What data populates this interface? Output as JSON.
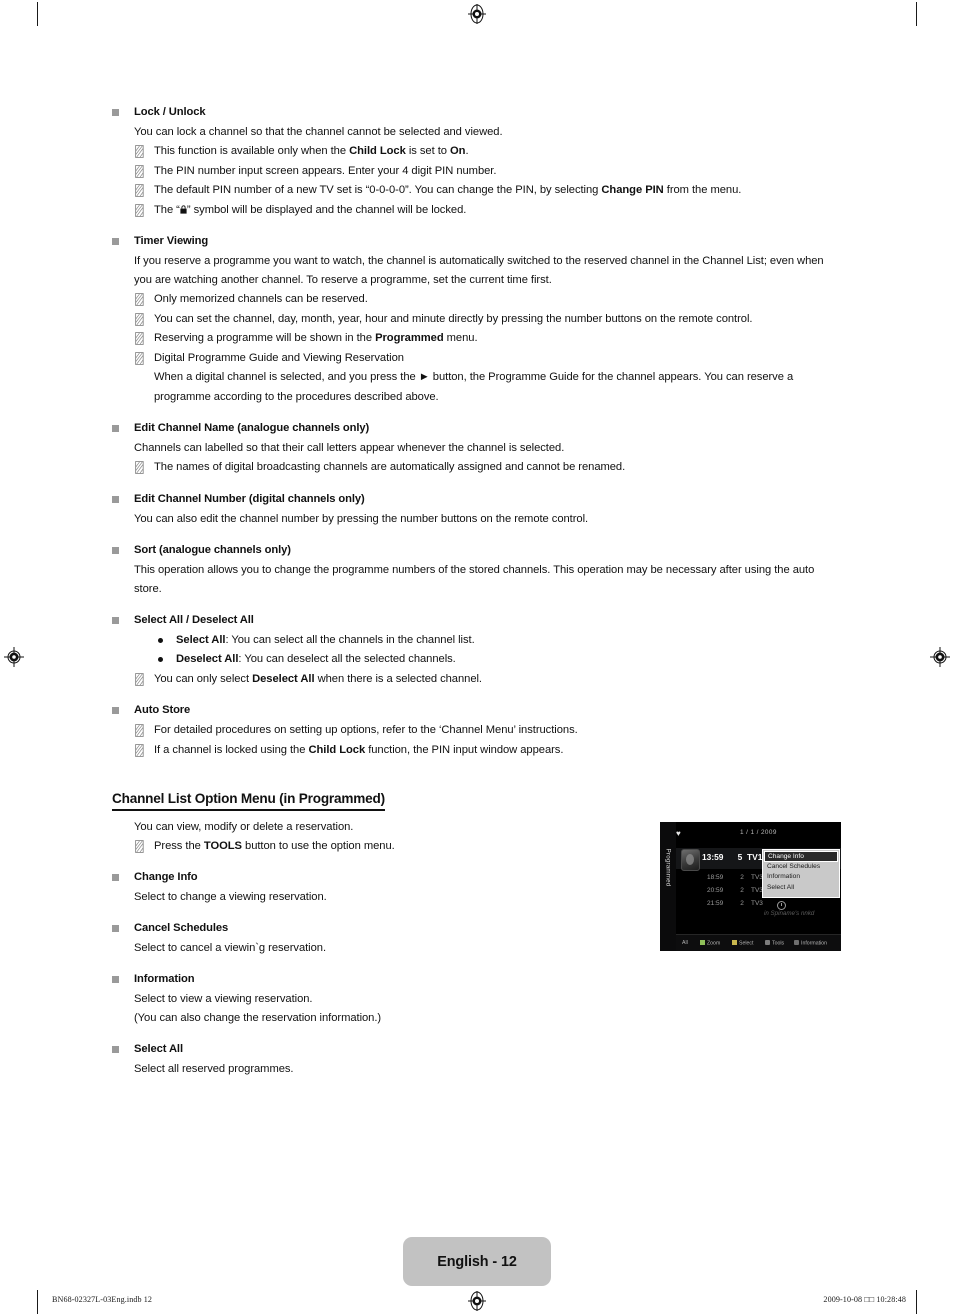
{
  "page": {
    "footer_tab_label": "English - 12",
    "colophon_left": "BN68-02327L-03Eng.indb   12",
    "colophon_right": "2009-10-08   □□ 10:28:48"
  },
  "sections": [
    {
      "heading": "Lock / Unlock",
      "body": "You can lock a channel so that the channel cannot be selected and viewed.",
      "notes": [
        "This function is available only when the Child Lock is set to On.",
        "The PIN number input screen appears. Enter your 4 digit PIN number.",
        "The default PIN number of a new TV set is “0-0-0-0”. You can change the PIN, by selecting Change PIN from the menu.",
        "The “🔒” symbol will be displayed and the channel will be locked."
      ]
    },
    {
      "heading": "Timer Viewing",
      "body": "If you reserve a programme you want to watch, the channel is automatically switched to the reserved channel in the Channel List; even when you are watching another channel. To reserve a programme, set the current time first.",
      "notes": [
        "Only memorized channels can be reserved.",
        "You can set the channel, day, month, year, hour and minute directly by pressing the number buttons on the remote control.",
        "Reserving a programme will be shown in the Programmed menu.",
        "Digital Programme Guide and Viewing Reservation"
      ],
      "note_sub": "When a digital channel is selected, and you press the ► button, the Programme Guide for the channel appears. You can reserve a programme according to the procedures described above."
    },
    {
      "heading": "Edit Channel Name (analogue channels only)",
      "body": "Channels can labelled so that their call letters appear whenever the channel is selected.",
      "notes": [
        "The names of digital broadcasting channels are automatically assigned and cannot be renamed."
      ]
    },
    {
      "heading": "Edit Channel Number (digital channels only)",
      "body": "You can also edit the channel number by pressing the number buttons on the remote control.",
      "notes": []
    },
    {
      "heading": "Sort (analogue channels only)",
      "body": "This operation allows you to change the programme numbers of the stored channels. This operation may be necessary after using the auto store.",
      "notes": []
    },
    {
      "heading": "Select All / Deselect All",
      "body": "",
      "dots": [
        "Select All: You can select all the channels in the channel list.",
        "Deselect All: You can deselect all the selected channels."
      ],
      "notes": [
        "You can only select Deselect All when there is a selected channel."
      ]
    },
    {
      "heading": "Auto Store",
      "body": "",
      "notes": [
        "For detailed procedures on setting up options, refer to the ‘Channel Menu’ instructions.",
        "If a channel is locked using the Child Lock function, the PIN input window appears."
      ]
    }
  ],
  "option_menu_section": {
    "title": "Channel List Option Menu (in Programmed)",
    "intro": "You can view, modify or delete a reservation.",
    "note": "Press the TOOLS button to use the option menu.",
    "items": [
      {
        "heading": "Change Info",
        "lines": [
          "Select to change a viewing reservation."
        ]
      },
      {
        "heading": "Cancel Schedules",
        "lines": [
          "Select to cancel a viewin`g reservation."
        ]
      },
      {
        "heading": "Information",
        "lines": [
          "Select to view a viewing reservation.",
          "(You can also change the reservation information.)"
        ]
      },
      {
        "heading": "Select All",
        "lines": [
          "Select all reserved programmes."
        ]
      }
    ]
  },
  "tv_screenshot": {
    "side_label": "Programmed",
    "date": "1 / 1 / 2009",
    "rows": [
      {
        "time": "13:59",
        "num": "5",
        "channel": "TV1",
        "current": true
      },
      {
        "time": "18:59",
        "num": "2",
        "channel": "TV3",
        "current": false
      },
      {
        "time": "20:59",
        "num": "2",
        "channel": "TV3",
        "current": false
      },
      {
        "time": "21:59",
        "num": "2",
        "channel": "TV3",
        "current": false
      }
    ],
    "ghost_text": "in Spiname's nnkd",
    "menu": [
      {
        "label": "Change Info",
        "selected": true
      },
      {
        "label": "Cancel Schedules",
        "selected": false
      },
      {
        "label": "Information",
        "selected": false
      },
      {
        "label": "Select All",
        "selected": false
      }
    ],
    "bottom_bar": [
      {
        "label": "All",
        "key": "none"
      },
      {
        "label": "Zoom",
        "key": "green"
      },
      {
        "label": "Select",
        "key": "yellow"
      },
      {
        "label": "Tools",
        "key": "tools"
      },
      {
        "label": "Information",
        "key": "info"
      }
    ]
  },
  "colors": {
    "square_bullet": "#9a9a9a",
    "page_tab": "#c2c2c2",
    "tv_menu_bg": "#c9c9c9"
  }
}
